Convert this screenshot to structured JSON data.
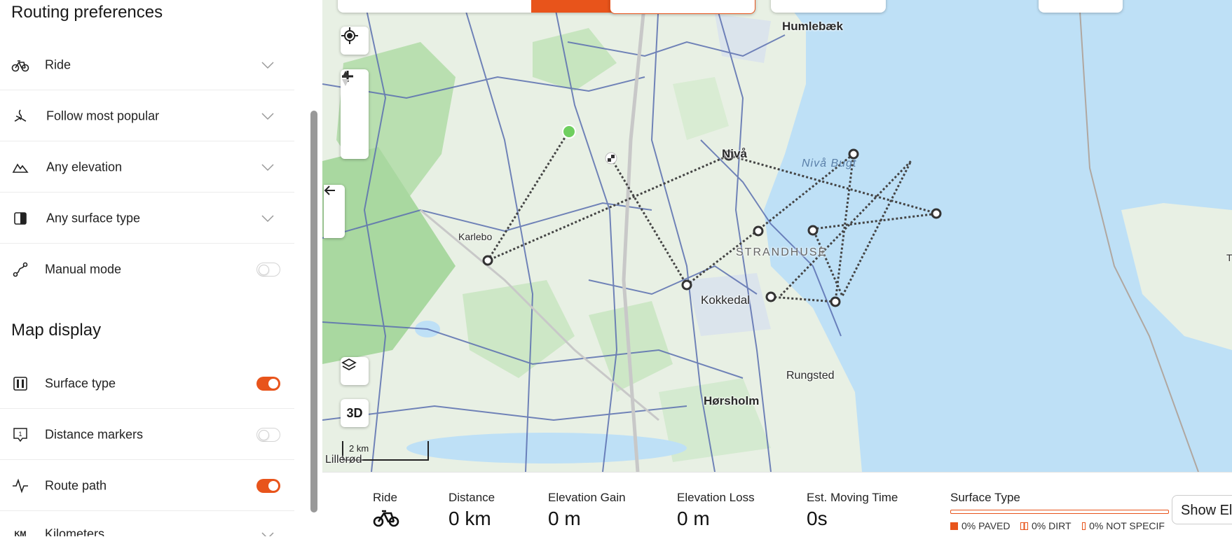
{
  "sidebar": {
    "routing_title": "Routing preferences",
    "routing_items": [
      {
        "label": "Ride",
        "icon": "bicycle-icon"
      },
      {
        "label": "Follow most popular",
        "icon": "popular-route-icon"
      },
      {
        "label": "Any elevation",
        "icon": "mountain-icon"
      },
      {
        "label": "Any surface type",
        "icon": "surface-type-icon"
      },
      {
        "label": "Manual mode",
        "icon": "manual-route-icon",
        "toggle": false
      }
    ],
    "display_title": "Map display",
    "display_items": [
      {
        "label": "Surface type",
        "icon": "surface-type-icon",
        "toggle": true
      },
      {
        "label": "Distance markers",
        "icon": "distance-marker-icon",
        "toggle": false
      },
      {
        "label": "Route path",
        "icon": "route-path-icon",
        "toggle": true
      },
      {
        "label": "Kilometers",
        "icon": "km-units-icon"
      }
    ]
  },
  "map": {
    "places": [
      "Humlebæk",
      "Nivå",
      "Nivå Bugt",
      "Karlebo",
      "STRANDHUSE",
      "Kokkedal",
      "Rungsted",
      "Hørsholm",
      "Lillerød",
      "T"
    ],
    "scale_label": "2 km",
    "btn_3d": "3D",
    "colors": {
      "land": "#e7efe4",
      "water": "#bee0f6",
      "forest": "#a9d8a0",
      "road": "#5b6fb0",
      "accent": "#e8541b"
    }
  },
  "stats": {
    "ride_label": "Ride",
    "distance_label": "Distance",
    "distance_value": "0 km",
    "gain_label": "Elevation Gain",
    "gain_value": "0 m",
    "loss_label": "Elevation Loss",
    "loss_value": "0 m",
    "time_label": "Est. Moving Time",
    "time_value": "0s",
    "surface_label": "Surface Type",
    "legend": [
      "0% PAVED",
      "0% DIRT",
      "0% NOT SPECIF"
    ],
    "show_button": "Show El"
  }
}
